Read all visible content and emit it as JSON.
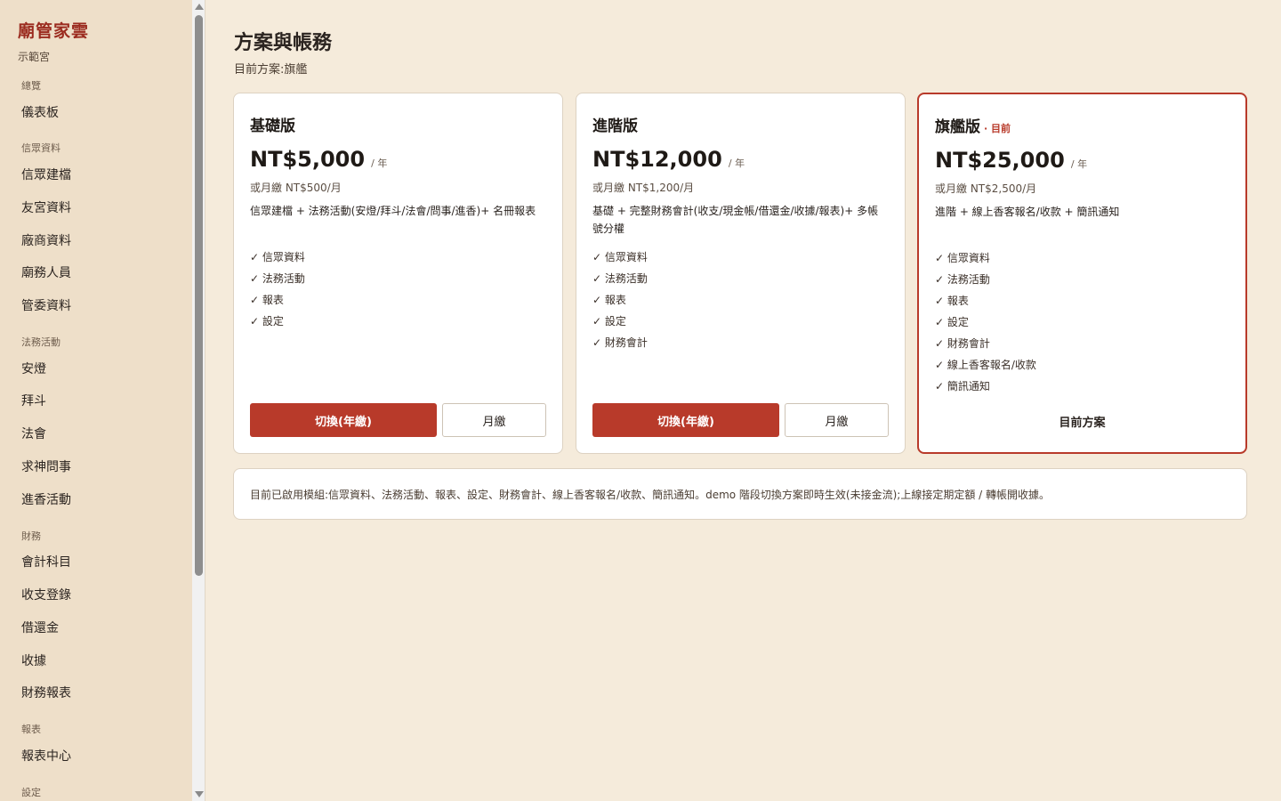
{
  "sidebar": {
    "brand_title": "廟管家雲",
    "brand_sub": "示範宮",
    "groups": [
      {
        "label": "總覽",
        "items": [
          "儀表板"
        ]
      },
      {
        "label": "信眾資料",
        "items": [
          "信眾建檔",
          "友宮資料",
          "廠商資料",
          "廟務人員",
          "管委資料"
        ]
      },
      {
        "label": "法務活動",
        "items": [
          "安燈",
          "拜斗",
          "法會",
          "求神問事",
          "進香活動"
        ]
      },
      {
        "label": "財務",
        "items": [
          "會計科目",
          "收支登錄",
          "借還金",
          "收據",
          "財務報表"
        ]
      },
      {
        "label": "報表",
        "items": [
          "報表中心"
        ]
      },
      {
        "label": "設定",
        "items": []
      }
    ]
  },
  "page": {
    "title": "方案與帳務",
    "current_plan": "目前方案:旗艦"
  },
  "plans": [
    {
      "name": "基礎版",
      "price": "NT$5,000",
      "unit": "/ 年",
      "monthly": "或月繳 NT$500/月",
      "desc": "信眾建檔 + 法務活動(安燈/拜斗/法會/問事/進香)+ 名冊報表",
      "features": [
        "✓ 信眾資料",
        "✓ 法務活動",
        "✓ 報表",
        "✓ 設定"
      ],
      "btn_primary": "切換(年繳)",
      "btn_secondary": "月繳"
    },
    {
      "name": "進階版",
      "price": "NT$12,000",
      "unit": "/ 年",
      "monthly": "或月繳 NT$1,200/月",
      "desc": "基礎 + 完整財務會計(收支/現金帳/借還金/收據/報表)+ 多帳號分權",
      "features": [
        "✓ 信眾資料",
        "✓ 法務活動",
        "✓ 報表",
        "✓ 設定",
        "✓ 財務會計"
      ],
      "btn_primary": "切換(年繳)",
      "btn_secondary": "月繳"
    },
    {
      "name": "旗艦版",
      "badge": "· 目前",
      "price": "NT$25,000",
      "unit": "/ 年",
      "monthly": "或月繳 NT$2,500/月",
      "desc": "進階 + 線上香客報名/收款 + 簡訊通知",
      "features": [
        "✓ 信眾資料",
        "✓ 法務活動",
        "✓ 報表",
        "✓ 設定",
        "✓ 財務會計",
        "✓ 線上香客報名/收款",
        "✓ 簡訊通知"
      ],
      "current_label": "目前方案"
    }
  ],
  "note": "目前已啟用模組:信眾資料、法務活動、報表、設定、財務會計、線上香客報名/收款、簡訊通知。demo 階段切換方案即時生效(未接金流);上線接定期定額 / 轉帳開收據。",
  "colors": {
    "accent": "#b83a2a",
    "background": "#f5ebdb",
    "sidebar": "#eedfc9"
  }
}
